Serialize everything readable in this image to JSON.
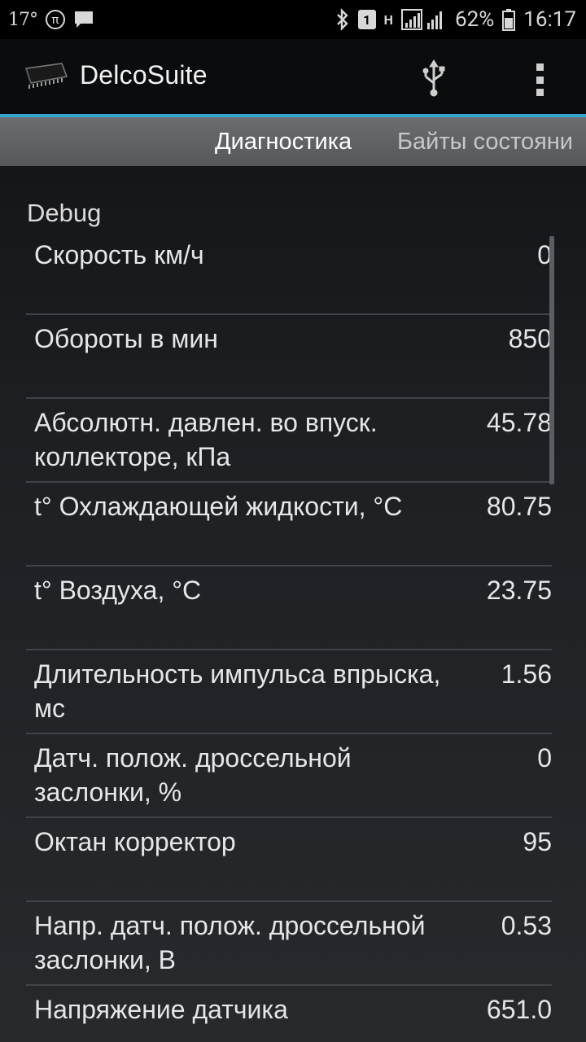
{
  "status_bar": {
    "temperature": "17°",
    "battery_percent": "62%",
    "time": "16:17",
    "sim_label": "1",
    "network_label": "H",
    "icons": [
      "pi-icon",
      "chat-icon",
      "bluetooth-icon",
      "sim-icon",
      "signal-icon",
      "battery-icon"
    ]
  },
  "action_bar": {
    "app_name": "DelcoSuite",
    "icons": [
      "chip-icon",
      "usb-icon",
      "overflow-menu-icon"
    ]
  },
  "tabs": [
    {
      "label": "Диагностика",
      "active": true
    },
    {
      "label": "Байты состояни",
      "active": false
    }
  ],
  "section": {
    "title": "Debug"
  },
  "rows": [
    {
      "label": "Скорость км/ч",
      "value": "0"
    },
    {
      "label": "Обороты в мин",
      "value": "850"
    },
    {
      "label": "Абсолютн. давлен. во впуск. коллекторе, кПа",
      "value": "45.78"
    },
    {
      "label": "t° Охлаждающей жидкости, °С",
      "value": "80.75"
    },
    {
      "label": "t° Воздуха, °С",
      "value": "23.75"
    },
    {
      "label": "Длительность импульса впрыска, мс",
      "value": "1.56"
    },
    {
      "label": "Датч. полож. дроссельной заслонки, %",
      "value": "0"
    },
    {
      "label": "Октан корректор",
      "value": "95"
    },
    {
      "label": "Напр. датч. полож. дроссельной заслонки, В",
      "value": "0.53"
    },
    {
      "label": "Напряжение датчика",
      "value": "651.0"
    }
  ],
  "colors": {
    "accent": "#35a6cc",
    "background": "#1e2124",
    "tab_bar": "#606366",
    "action_bar": "#0b0c0d"
  }
}
